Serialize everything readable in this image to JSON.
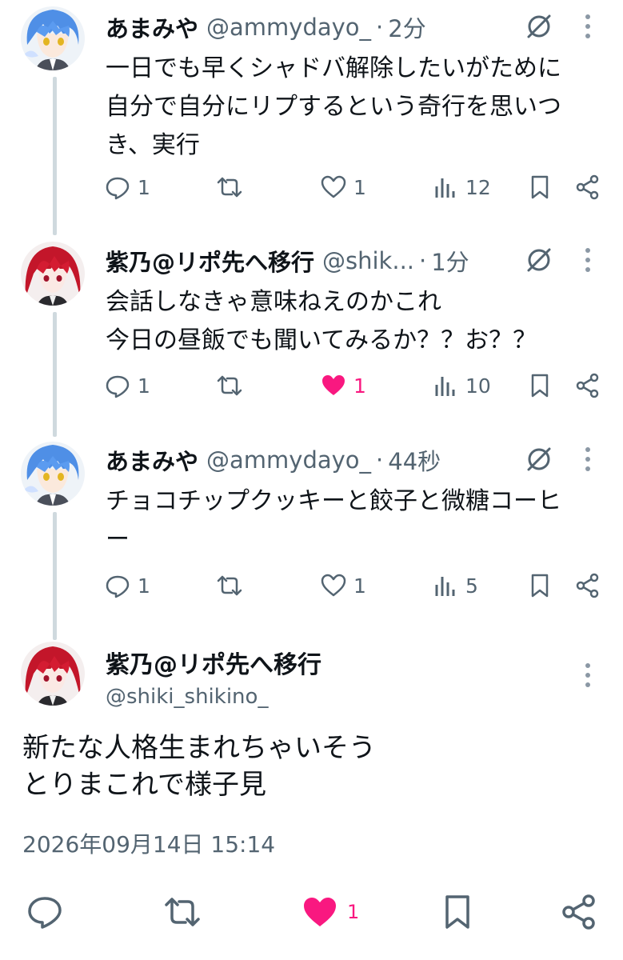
{
  "thread": [
    {
      "name": "あまみや",
      "handle": "@ammydayo_",
      "time": "2分",
      "text": "一日でも早くシャドバ解除したいがために\n自分で自分にリプするという奇行を思いつ\nき、実行",
      "replies": "1",
      "retweets": "",
      "likes": "1",
      "liked": false,
      "views": "12",
      "avatar": "blue-hair-avatar"
    },
    {
      "name": "紫乃@リポ先へ移行",
      "handle": "@shik...",
      "time": "1分",
      "text": "会話しなきゃ意味ねえのかこれ\n今日の昼飯でも聞いてみるか？？お？？",
      "replies": "1",
      "retweets": "",
      "likes": "1",
      "liked": true,
      "views": "10",
      "avatar": "red-hair-avatar"
    },
    {
      "name": "あまみや",
      "handle": "@ammydayo_",
      "time": "44秒",
      "text": "チョコチップクッキーと餃子と微糖コーヒ\nー",
      "replies": "1",
      "retweets": "",
      "likes": "1",
      "liked": false,
      "views": "5",
      "avatar": "blue-hair-avatar"
    }
  ],
  "main_post": {
    "name": "紫乃@リポ先へ移行",
    "handle": "@shiki_shikino_",
    "text": "新たな人格生まれちゃいそう\nとりまこれで様子見",
    "timestamp": "2026年09月14日 15:14",
    "likes": "1",
    "liked": true,
    "avatar": "red-hair-avatar"
  },
  "colors": {
    "like_pink": "#f91880",
    "secondary_text": "#536471",
    "thread_line": "#cfd9de",
    "primary_text": "#0f1419"
  }
}
